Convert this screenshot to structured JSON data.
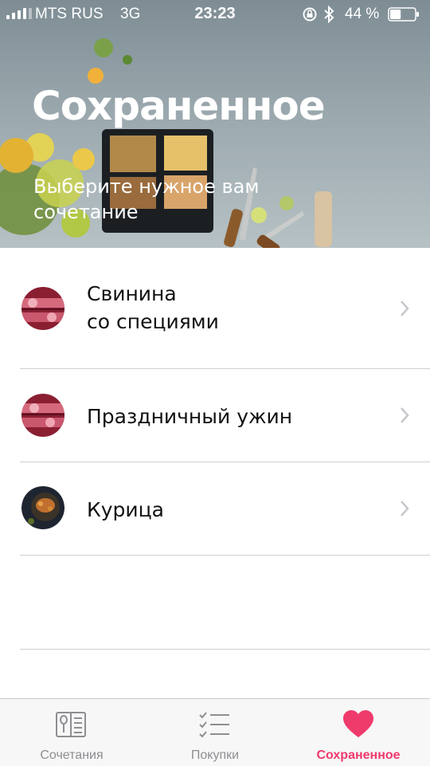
{
  "status_bar": {
    "carrier": "MTS RUS",
    "network": "3G",
    "time": "23:23",
    "battery": "44 %",
    "battery_level": 0.44
  },
  "hero": {
    "title": "Сохраненное",
    "subtitle": "Выберите нужное вам сочетание"
  },
  "saved_items": [
    {
      "label": "Свинина\nсо специями",
      "icon": "pork-dish-thumbnail"
    },
    {
      "label": "Праздничный ужин",
      "icon": "pork-dish-thumbnail"
    },
    {
      "label": "Курица",
      "icon": "chicken-dish-thumbnail"
    }
  ],
  "tabbar": {
    "tabs": [
      {
        "label": "Сочетания",
        "icon": "recipe-book-icon",
        "active": false
      },
      {
        "label": "Покупки",
        "icon": "checklist-icon",
        "active": false
      },
      {
        "label": "Сохраненное",
        "icon": "heart-icon",
        "active": true
      }
    ]
  },
  "colors": {
    "accent": "#ef3a6c",
    "inactive_tab": "#8e8e93",
    "divider": "#cfcfd4"
  }
}
